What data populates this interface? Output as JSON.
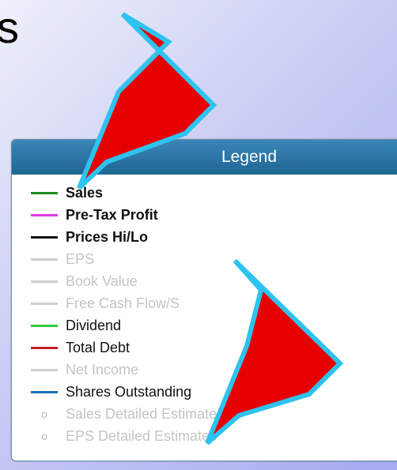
{
  "top_text": "s",
  "legend": {
    "title": "Legend",
    "items": [
      {
        "label": "Sales",
        "color": "#1f8a1f",
        "style": "bold"
      },
      {
        "label": "Pre-Tax Profit",
        "color": "#e23ce0",
        "style": "bold"
      },
      {
        "label": "Prices Hi/Lo",
        "color": "#111111",
        "style": "bold"
      },
      {
        "label": "EPS",
        "color": "#cfcfcf",
        "style": "disabled"
      },
      {
        "label": "Book Value",
        "color": "#cfcfcf",
        "style": "disabled"
      },
      {
        "label": "Free Cash Flow/S",
        "color": "#cfcfcf",
        "style": "disabled"
      },
      {
        "label": "Dividend",
        "color": "#38c93d",
        "style": "normal"
      },
      {
        "label": "Total Debt",
        "color": "#c31f28",
        "style": "normal"
      },
      {
        "label": "Net Income",
        "color": "#cfcfcf",
        "style": "disabled"
      },
      {
        "label": "Shares Outstanding",
        "color": "#1d6fb8",
        "style": "normal"
      },
      {
        "label": "Sales Detailed Estimates",
        "bullet": "o",
        "style": "disabled"
      },
      {
        "label": "EPS Detailed Estimates",
        "bullet": "o",
        "style": "disabled"
      }
    ]
  },
  "annotations": {
    "arrow_color": "#e60000",
    "arrow_outline": "#2ec3ef"
  }
}
